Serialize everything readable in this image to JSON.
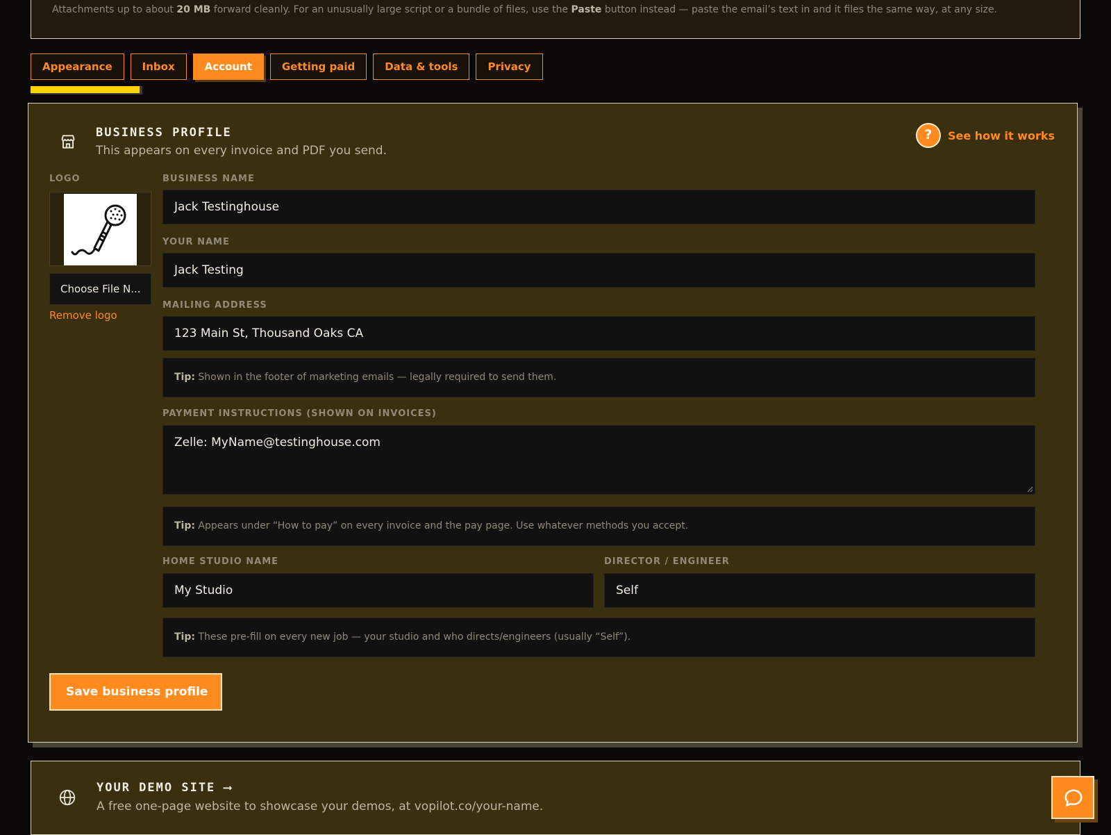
{
  "notice": {
    "text_a": "Attachments up to about ",
    "size": "20 MB",
    "text_b": " forward cleanly. For an unusually large script or a bundle of files, use the ",
    "paste": "Paste",
    "text_c": " button instead — paste the email’s text in and it files the same way, at any size."
  },
  "tabs": [
    {
      "label": "Appearance"
    },
    {
      "label": "Inbox"
    },
    {
      "label": "Account"
    },
    {
      "label": "Getting paid"
    },
    {
      "label": "Data & tools"
    },
    {
      "label": "Privacy"
    }
  ],
  "active_tab": "Account",
  "business_profile": {
    "title": "BUSINESS PROFILE",
    "subtitle": "This appears on every invoice and PDF you send.",
    "help_link": "See how it works",
    "help_icon_glyph": "?",
    "logo_label": "LOGO",
    "choose_file": "Choose File N...",
    "remove_logo": "Remove logo",
    "business_name_label": "BUSINESS NAME",
    "business_name": "Jack Testinghouse",
    "your_name_label": "YOUR NAME",
    "your_name": "Jack Testing",
    "mailing_address_label": "MAILING ADDRESS",
    "mailing_address": "123 Main St, Thousand Oaks CA",
    "tip_prefix": "Tip:",
    "tip_address": "Shown in the footer of marketing emails — legally required to send them.",
    "payment_label": "PAYMENT INSTRUCTIONS (SHOWN ON INVOICES)",
    "payment": "Zelle: MyName@testinghouse.com",
    "tip_payment": "Appears under “How to pay” on every invoice and the pay page. Use whatever methods you accept.",
    "studio_label": "HOME STUDIO NAME",
    "studio": "My Studio",
    "director_label": "DIRECTOR / ENGINEER",
    "director": "Self",
    "tip_studio": "These pre-fill on every new job — your studio and who directs/engineers (usually “Self”).",
    "save_label": "Save business profile"
  },
  "demo_site": {
    "title": "YOUR DEMO SITE",
    "arrow": "⟶",
    "subtitle": "A free one-page website to showcase your demos, at vopilot.co/your-name."
  },
  "icons": {
    "store": "storefront-icon",
    "help": "question-icon",
    "logo": "microphone-icon",
    "globe": "globe-icon",
    "chat": "chat-bubble-icon"
  },
  "colors": {
    "accent": "#ff8a1e",
    "card_bg": "#3a3010",
    "field_bg": "#121111",
    "tab_indicator": "#ffd20a"
  }
}
